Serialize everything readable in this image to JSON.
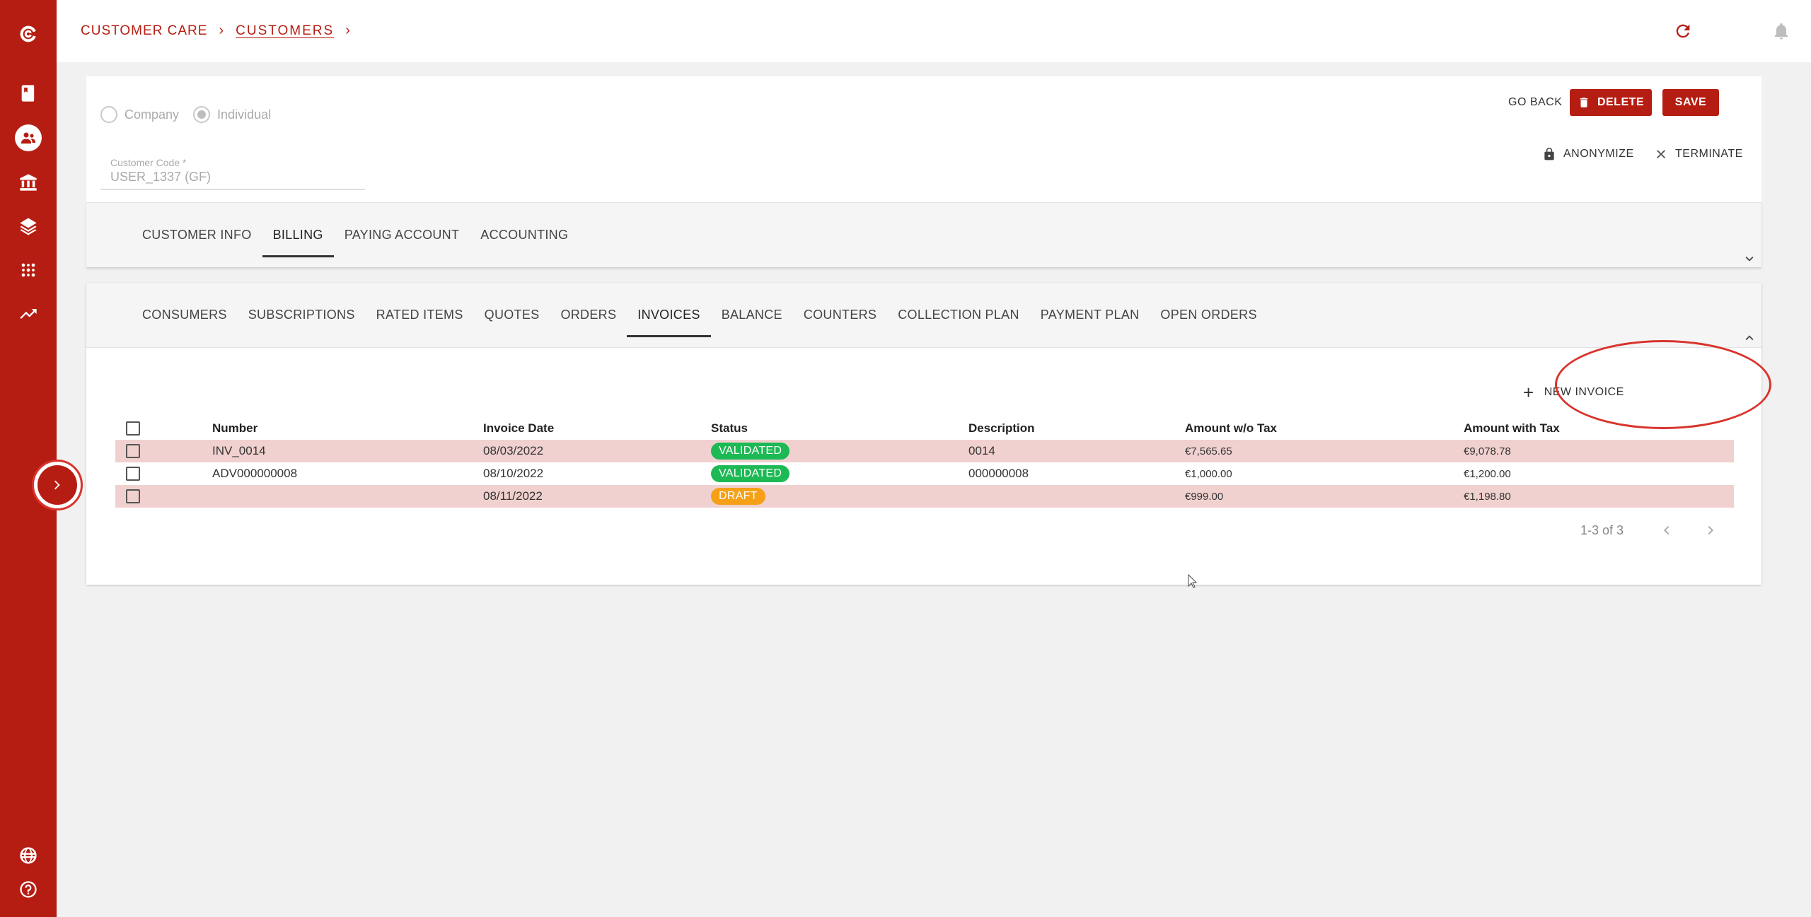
{
  "colors": {
    "brand": "#b61d12",
    "validated": "#1db954",
    "draft": "#f5a017",
    "row_shaded": "#f0d1cf",
    "highlight": "#d9332b"
  },
  "sidebar": {
    "icons": [
      "logo-icon",
      "book-icon",
      "customers-icon",
      "bank-icon",
      "layers-icon",
      "apps-icon",
      "trending-icon",
      "language-icon",
      "help-icon"
    ],
    "active": "customers-icon"
  },
  "breadcrumb": {
    "root": "CUSTOMER CARE",
    "current": "CUSTOMERS"
  },
  "header_icons": [
    "refresh-icon",
    "bell-icon",
    "account-icon"
  ],
  "customer": {
    "type_options": [
      "Company",
      "Individual"
    ],
    "selected_type": "Individual",
    "code_label": "Customer Code *",
    "code_value": "USER_1337 (GF)"
  },
  "actions": {
    "go_back": "GO BACK",
    "delete": "DELETE",
    "save": "SAVE",
    "anonymize": "ANONYMIZE",
    "terminate": "TERMINATE"
  },
  "main_tabs": [
    "CUSTOMER INFO",
    "BILLING",
    "PAYING ACCOUNT",
    "ACCOUNTING"
  ],
  "main_tab_active": "BILLING",
  "billing_tabs": [
    "CONSUMERS",
    "SUBSCRIPTIONS",
    "RATED ITEMS",
    "QUOTES",
    "ORDERS",
    "INVOICES",
    "BALANCE",
    "COUNTERS",
    "COLLECTION PLAN",
    "PAYMENT PLAN",
    "OPEN ORDERS"
  ],
  "billing_tab_active": "INVOICES",
  "new_invoice_label": "NEW INVOICE",
  "table": {
    "columns": [
      "Number",
      "Invoice Date",
      "Status",
      "Description",
      "Amount w/o Tax",
      "Amount with Tax"
    ],
    "rows": [
      {
        "number": "INV_0014",
        "date": "08/03/2022",
        "status": "VALIDATED",
        "description": "0014",
        "amount_net": "€7,565.65",
        "amount_gross": "€9,078.78"
      },
      {
        "number": "ADV000000008",
        "date": "08/10/2022",
        "status": "VALIDATED",
        "description": "000000008",
        "amount_net": "€1,000.00",
        "amount_gross": "€1,200.00"
      },
      {
        "number": "",
        "date": "08/11/2022",
        "status": "DRAFT",
        "description": "",
        "amount_net": "€999.00",
        "amount_gross": "€1,198.80"
      }
    ]
  },
  "pagination": {
    "label": "1-3 of 3"
  }
}
